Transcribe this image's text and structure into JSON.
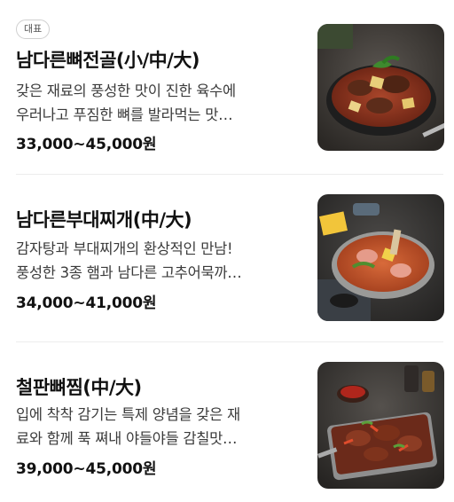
{
  "menu": {
    "items": [
      {
        "badge": "대표",
        "name": "남다른뼈전골(小/中/大)",
        "desc_line1": "갖은 재료의 풍성한 맛이 진한 육수에",
        "desc_line2": "우러나고 푸짐한 뼈를 발라먹는 맛…",
        "price": "33,000~45,000원",
        "image_icon": "bone-stew-hotpot-photo"
      },
      {
        "name": "남다른부대찌개(中/大)",
        "desc_line1": "감자탕과 부대찌개의 환상적인 만남!",
        "desc_line2": "풍성한 3종 햄과 남다른 고추어묵까…",
        "price": "34,000~41,000원",
        "image_icon": "army-stew-photo"
      },
      {
        "name": "철판뼈찜(中/大)",
        "desc_line1": "입에 착착 감기는 특제 양념을 갖은 재",
        "desc_line2": "료와 함께 푹 쪄내 야들야들 감칠맛…",
        "price": "39,000~45,000원",
        "image_icon": "iron-plate-bone-braise-photo"
      }
    ]
  },
  "colors": {
    "text": "#111111",
    "desc": "#3b3b3b",
    "divider": "#ececec",
    "badge_border": "#cfcfcf"
  }
}
